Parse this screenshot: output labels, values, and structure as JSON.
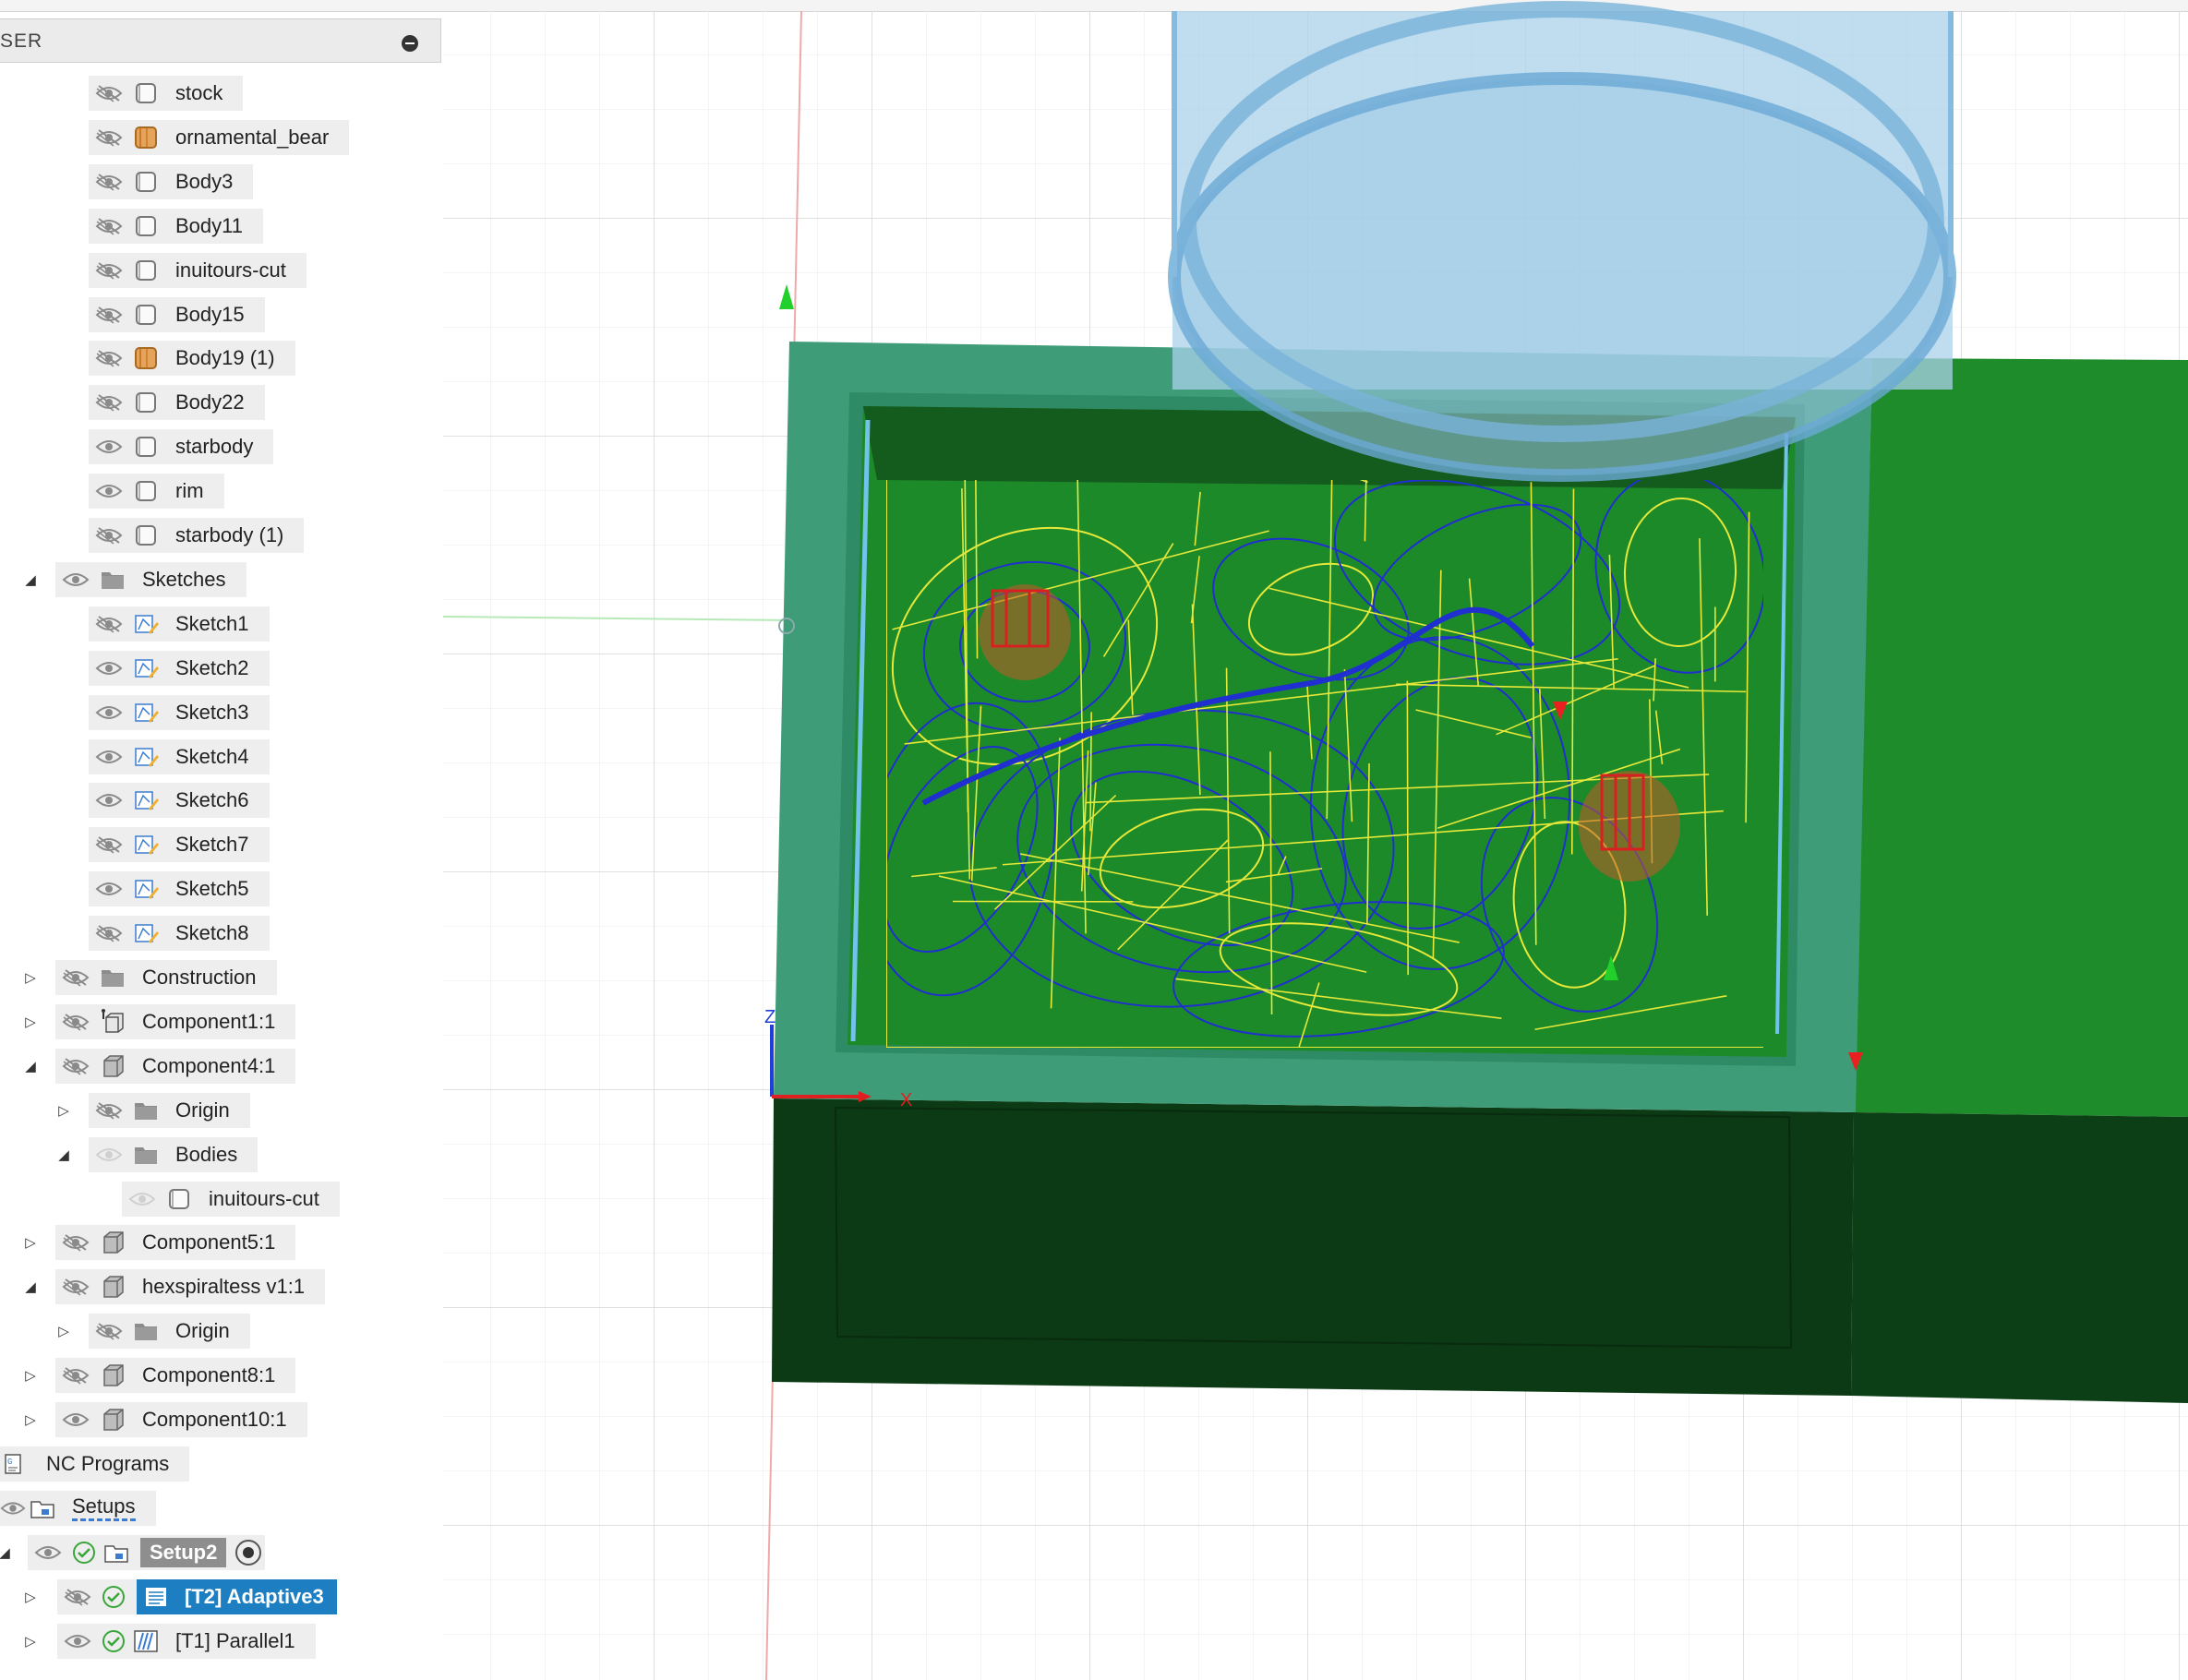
{
  "browser": {
    "title": "SER",
    "rows": [
      {
        "label": "stock",
        "indent": 2,
        "eye": "hidden",
        "icon": "body-icon",
        "expander": ""
      },
      {
        "label": "ornamental_bear",
        "indent": 2,
        "eye": "hidden",
        "icon": "body-orange-icon",
        "expander": ""
      },
      {
        "label": "Body3",
        "indent": 2,
        "eye": "hidden",
        "icon": "body-icon",
        "expander": ""
      },
      {
        "label": "Body11",
        "indent": 2,
        "eye": "hidden",
        "icon": "body-icon",
        "expander": ""
      },
      {
        "label": "inuitours-cut",
        "indent": 2,
        "eye": "hidden",
        "icon": "body-icon",
        "expander": ""
      },
      {
        "label": "Body15",
        "indent": 2,
        "eye": "hidden",
        "icon": "body-icon",
        "expander": ""
      },
      {
        "label": "Body19 (1)",
        "indent": 2,
        "eye": "hidden",
        "icon": "body-orange-icon",
        "expander": ""
      },
      {
        "label": "Body22",
        "indent": 2,
        "eye": "hidden",
        "icon": "body-icon",
        "expander": ""
      },
      {
        "label": "starbody",
        "indent": 2,
        "eye": "visible",
        "icon": "body-icon",
        "expander": ""
      },
      {
        "label": "rim",
        "indent": 2,
        "eye": "visible",
        "icon": "body-icon",
        "expander": ""
      },
      {
        "label": "starbody (1)",
        "indent": 2,
        "eye": "hidden",
        "icon": "body-icon",
        "expander": ""
      },
      {
        "label": "Sketches",
        "indent": 1,
        "eye": "visible",
        "icon": "folder-icon",
        "expander": "open"
      },
      {
        "label": "Sketch1",
        "indent": 2,
        "eye": "hidden",
        "icon": "sketch-icon",
        "expander": ""
      },
      {
        "label": "Sketch2",
        "indent": 2,
        "eye": "visible",
        "icon": "sketch-icon",
        "expander": ""
      },
      {
        "label": "Sketch3",
        "indent": 2,
        "eye": "visible",
        "icon": "sketch-icon",
        "expander": ""
      },
      {
        "label": "Sketch4",
        "indent": 2,
        "eye": "visible",
        "icon": "sketch-icon",
        "expander": ""
      },
      {
        "label": "Sketch6",
        "indent": 2,
        "eye": "visible",
        "icon": "sketch-icon",
        "expander": ""
      },
      {
        "label": "Sketch7",
        "indent": 2,
        "eye": "hidden",
        "icon": "sketch-icon",
        "expander": ""
      },
      {
        "label": "Sketch5",
        "indent": 2,
        "eye": "visible",
        "icon": "sketch-icon",
        "expander": ""
      },
      {
        "label": "Sketch8",
        "indent": 2,
        "eye": "hidden",
        "icon": "sketch-icon",
        "expander": ""
      },
      {
        "label": "Construction",
        "indent": 1,
        "eye": "hidden",
        "icon": "folder-icon",
        "expander": "closed"
      },
      {
        "label": "Component1:1",
        "indent": 1,
        "eye": "hidden",
        "icon": "component-anchor-icon",
        "expander": "closed"
      },
      {
        "label": "Component4:1",
        "indent": 1,
        "eye": "hidden",
        "icon": "component-icon",
        "expander": "open"
      },
      {
        "label": "Origin",
        "indent": 2,
        "eye": "hidden",
        "icon": "folder-icon",
        "expander": "closed"
      },
      {
        "label": "Bodies",
        "indent": 2,
        "eye": "faint",
        "icon": "folder-icon",
        "expander": "open"
      },
      {
        "label": "inuitours-cut",
        "indent": 3,
        "eye": "faint",
        "icon": "body-icon",
        "expander": ""
      },
      {
        "label": "Component5:1",
        "indent": 1,
        "eye": "hidden",
        "icon": "component-icon",
        "expander": "closed"
      },
      {
        "label": "hexspiraltess v1:1",
        "indent": 1,
        "eye": "hidden",
        "icon": "component-icon",
        "expander": "open"
      },
      {
        "label": "Origin",
        "indent": 2,
        "eye": "hidden",
        "icon": "folder-icon",
        "expander": "closed"
      },
      {
        "label": "Component8:1",
        "indent": 1,
        "eye": "hidden",
        "icon": "component-icon",
        "expander": "closed"
      },
      {
        "label": "Component10:1",
        "indent": 1,
        "eye": "visible",
        "icon": "component-icon",
        "expander": "closed"
      }
    ],
    "nc_programs": "NC Programs",
    "setups": "Setups",
    "setup2": "Setup2",
    "op_adaptive": "[T2] Adaptive3",
    "op_parallel": "[T1] Parallel1"
  },
  "viewport": {
    "axis_z": "Z",
    "axis_x": "X"
  },
  "colors": {
    "stock_green": "#1e8a2a",
    "dark_green": "#0b3b14",
    "teal_rim": "#3b9a73",
    "toolpath_yellow": "#e6e83a",
    "toolpath_blue": "#1f2fd0",
    "selected_blue": "#1d7fc1"
  }
}
